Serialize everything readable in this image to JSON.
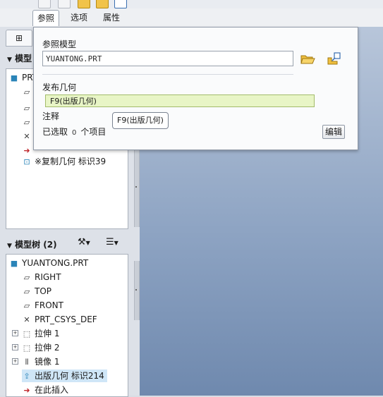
{
  "tabs": [
    {
      "label": "参照"
    },
    {
      "label": "选项"
    },
    {
      "label": "属性"
    }
  ],
  "reference_panel": {
    "ref_model_label": "参照模型",
    "ref_model_value": "YUANTONG.PRT",
    "publish_geom_label": "发布几何",
    "publish_geom_value": "F9(出版几何)",
    "tooltip": "F9(出版几何)",
    "note_label": "注释",
    "selected_prefix": "已选取",
    "selected_count": "0",
    "selected_suffix": "个项目",
    "edit_button": "编辑"
  },
  "upper_tree": {
    "title": "模型",
    "root": "PRT",
    "items": [
      {
        "label": "※复制几何 标识39",
        "icon": "copy-geometry-icon"
      }
    ]
  },
  "lower_tree": {
    "title": "模型树 (2)",
    "root": "YUANTONG.PRT",
    "items": [
      {
        "label": "RIGHT",
        "icon": "datum-plane-icon"
      },
      {
        "label": "TOP",
        "icon": "datum-plane-icon"
      },
      {
        "label": "FRONT",
        "icon": "datum-plane-icon"
      },
      {
        "label": "PRT_CSYS_DEF",
        "icon": "csys-icon"
      },
      {
        "label": "拉伸 1",
        "icon": "extrude-icon"
      },
      {
        "label": "拉伸 2",
        "icon": "extrude-icon"
      },
      {
        "label": "镜像 1",
        "icon": "mirror-icon"
      },
      {
        "label": "出版几何 标识214",
        "icon": "publish-geometry-icon"
      },
      {
        "label": "在此插入",
        "icon": "insert-here-icon"
      }
    ]
  },
  "colors": {
    "highlight": "#cfe6f7",
    "selection_fill": "#e8f5c6",
    "viewport_top": "#b8c6da",
    "viewport_bottom": "#6f89ae"
  }
}
